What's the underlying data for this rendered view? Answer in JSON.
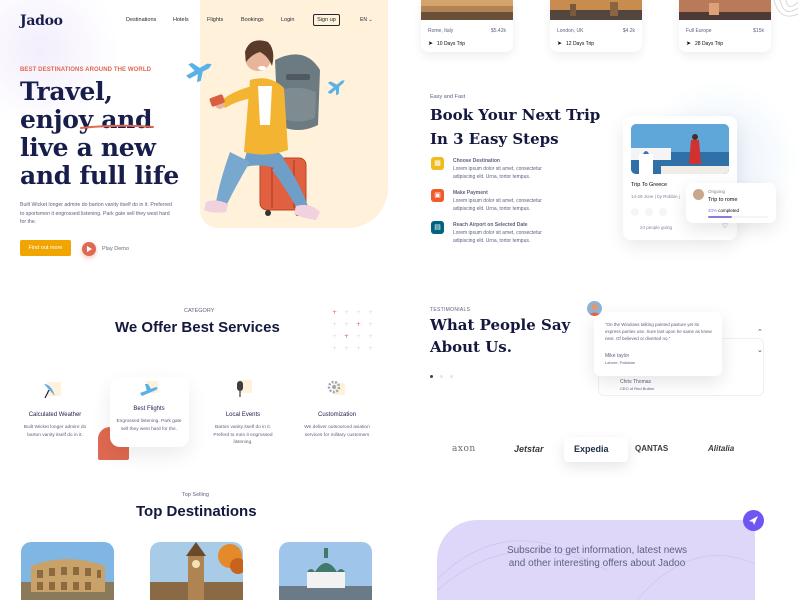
{
  "nav": {
    "logo": "Jadoo",
    "items": [
      "Destinations",
      "Hotels",
      "Flights",
      "Bookings",
      "Login"
    ],
    "signup": "Sign up",
    "lang": "EN"
  },
  "hero": {
    "tag": "BEST DESTINATIONS AROUND THE WORLD",
    "title_l1": "Travel,",
    "title_l2": "enjoy and",
    "title_l3": "live a new",
    "title_l4": "and full life",
    "desc": "Built Wicket longer admire do barton vanity itself do in it. Preferred to sportsmen it engrossed listening. Park gate sell they west hard for the.",
    "cta": "Find out more",
    "play": "Play Demo"
  },
  "trips": [
    {
      "dest": "Rome, Italy",
      "price": "$5.42k",
      "days": "10 Days Trip"
    },
    {
      "dest": "London, UK",
      "price": "$4.2k",
      "days": "12 Days Trip"
    },
    {
      "dest": "Full Europe",
      "price": "$15k",
      "days": "28 Days Trip"
    }
  ],
  "steps": {
    "tag": "Easy and Fast",
    "title_l1": "Book Your Next Trip",
    "title_l2": "In 3 Easy Steps",
    "items": [
      {
        "title": "Choose Destination",
        "desc": "Lorem ipsum dolor sit amet, consectetur adipiscing elit. Urna, tortor tempus.",
        "color": "#f0bb1f"
      },
      {
        "title": "Make Payment",
        "desc": "Lorem ipsum dolor sit amet, consectetur adipiscing elit. Urna, tortor tempus.",
        "color": "#f15a2b"
      },
      {
        "title": "Reach Airport on Selected Date",
        "desc": "Lorem ipsum dolor sit amet, consectetur adipiscing elit. Urna, tortor tempus.",
        "color": "#006380"
      }
    ]
  },
  "greece": {
    "name": "Trip To Greece",
    "meta": "14-29 June  |  by Robbin j",
    "going": "24 people going"
  },
  "rome": {
    "ongoing": "Ongoing",
    "title": "Trip to rome",
    "pct": "40%",
    "completed": "completed",
    "progress": 0.4
  },
  "services": {
    "tag": "CATEGORY",
    "title": "We Offer Best Services",
    "items": [
      {
        "name": "Calculated Weather",
        "desc": "Built Wicket longer admire do barton vanity itself do in it."
      },
      {
        "name": "Best Flights",
        "desc": "Engrossed listening. Park gate sell they west hard for the."
      },
      {
        "name": "Local Events",
        "desc": "Barton vanity itself do in it. Preferd to men it engrossed listening."
      },
      {
        "name": "Customization",
        "desc": "We deliver outsourced aviation services for military customers"
      }
    ]
  },
  "testimonials": {
    "tag": "TESTIMONIALS",
    "title_l1": "What People Say",
    "title_l2": "About Us.",
    "quote": "“On the Windows talking painted pasture yet its express parties use. Sure last upon he same as knew next. Of believed or diverted no.”",
    "author": "Mike taylor",
    "place": "Lahore, Pakistan",
    "author2": "Chris Thomas",
    "place2": "CEO of Red Button"
  },
  "brands": [
    "axon",
    "Jetstar",
    "Expedia",
    "QANTAS",
    "Alitalia"
  ],
  "destinations": {
    "tag": "Top Selling",
    "title": "Top Destinations"
  },
  "subscribe": {
    "text": "Subscribe to get information, latest news and other interesting offers about Jadoo"
  },
  "colors": {
    "accent": "#df6951",
    "cta": "#f1a501",
    "navy": "#181e4b",
    "purple": "#6f55f2"
  }
}
